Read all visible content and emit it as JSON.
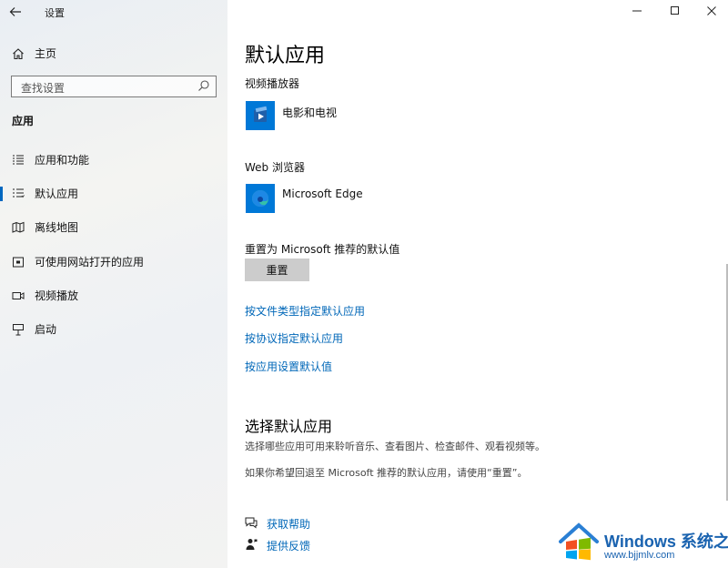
{
  "window": {
    "title": "设置"
  },
  "sidebar": {
    "home_label": "主页",
    "search_placeholder": "查找设置",
    "section_heading": "应用",
    "items": [
      {
        "label": "应用和功能",
        "icon": "apps-list-icon",
        "active": false
      },
      {
        "label": "默认应用",
        "icon": "default-apps-icon",
        "active": true
      },
      {
        "label": "离线地图",
        "icon": "offline-map-icon",
        "active": false
      },
      {
        "label": "可使用网站打开的应用",
        "icon": "apps-for-websites-icon",
        "active": false
      },
      {
        "label": "视频播放",
        "icon": "video-playback-icon",
        "active": false
      },
      {
        "label": "启动",
        "icon": "startup-icon",
        "active": false
      }
    ]
  },
  "main": {
    "title": "默认应用",
    "video_player": {
      "label": "视频播放器",
      "app_name": "电影和电视"
    },
    "web_browser": {
      "label": "Web 浏览器",
      "app_name": "Microsoft Edge"
    },
    "reset": {
      "label": "重置为 Microsoft 推荐的默认值",
      "button_label": "重置"
    },
    "links": [
      "按文件类型指定默认应用",
      "按协议指定默认应用",
      "按应用设置默认值"
    ],
    "choose_section": {
      "title": "选择默认应用",
      "desc1": "选择哪些应用可用来聆听音乐、查看图片、检查邮件、观看视频等。",
      "desc2": "如果你希望回退至 Microsoft 推荐的默认应用，请使用“重置”。"
    },
    "help": {
      "get_help": "获取帮助",
      "feedback": "提供反馈"
    }
  },
  "watermark": {
    "line1": "Windows 系统之家",
    "line2": "www.bjjmlv.com"
  },
  "colors": {
    "accent": "#0067c0",
    "link": "#0067b8",
    "tile_blue": "#0078d7"
  }
}
